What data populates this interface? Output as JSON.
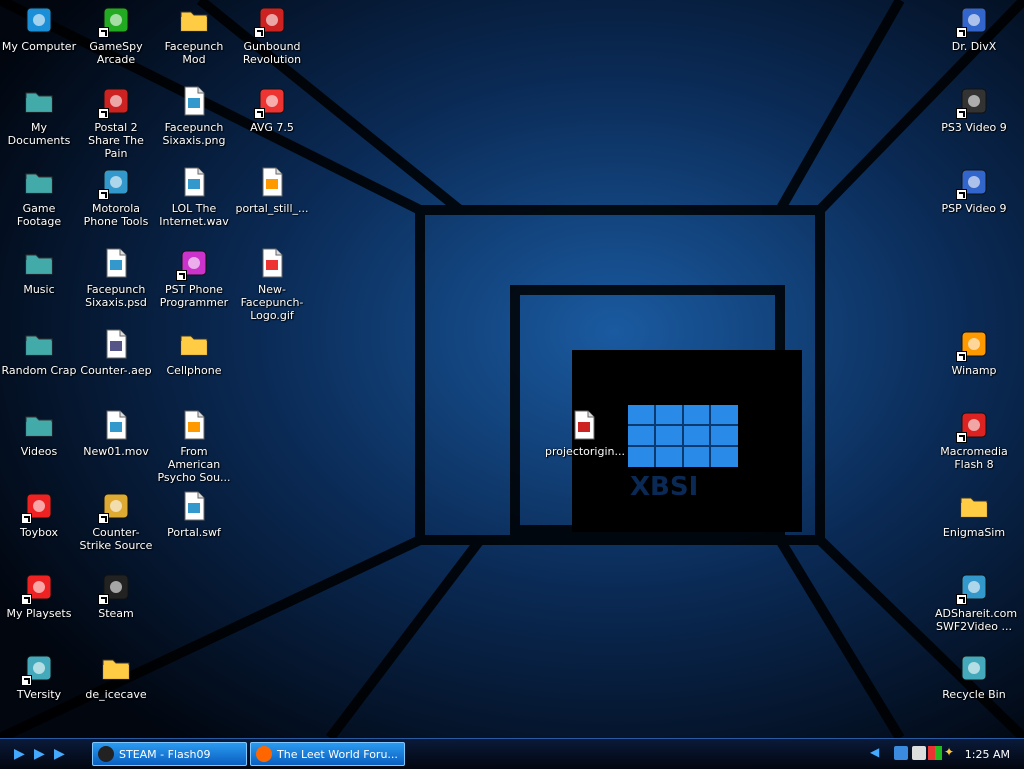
{
  "desktop": {
    "icons": [
      {
        "label": "My Computer",
        "icon": "my-computer-icon",
        "col": 0,
        "row": 0,
        "shortcut": false,
        "color": "#1a8fd8"
      },
      {
        "label": "My Documents",
        "icon": "folder-icon",
        "col": 0,
        "row": 1,
        "shortcut": false,
        "color": "#4aa"
      },
      {
        "label": "Game Footage",
        "icon": "folder-icon",
        "col": 0,
        "row": 2,
        "shortcut": false,
        "color": "#4aa"
      },
      {
        "label": "Music",
        "icon": "folder-icon",
        "col": 0,
        "row": 3,
        "shortcut": false,
        "color": "#4aa"
      },
      {
        "label": "Random Crap",
        "icon": "folder-icon",
        "col": 0,
        "row": 4,
        "shortcut": false,
        "color": "#4aa"
      },
      {
        "label": "Videos",
        "icon": "folder-icon",
        "col": 0,
        "row": 5,
        "shortcut": false,
        "color": "#4aa"
      },
      {
        "label": "Toybox",
        "icon": "toybox-icon",
        "col": 0,
        "row": 6,
        "shortcut": true,
        "color": "#e22"
      },
      {
        "label": "My Playsets",
        "icon": "playsets-icon",
        "col": 0,
        "row": 7,
        "shortcut": true,
        "color": "#e22"
      },
      {
        "label": "TVersity",
        "icon": "tversity-icon",
        "col": 0,
        "row": 8,
        "shortcut": true,
        "color": "#4ab"
      },
      {
        "label": "GameSpy Arcade",
        "icon": "gamespy-icon",
        "col": 1,
        "row": 0,
        "shortcut": true,
        "color": "#2a2"
      },
      {
        "label": "Postal 2 Share The Pain",
        "icon": "postal-icon",
        "col": 1,
        "row": 1,
        "shortcut": true,
        "color": "#c22"
      },
      {
        "label": "Motorola Phone Tools",
        "icon": "motorola-icon",
        "col": 1,
        "row": 2,
        "shortcut": true,
        "color": "#39c"
      },
      {
        "label": "Facepunch Sixaxis.psd",
        "icon": "psd-file-icon",
        "col": 1,
        "row": 3,
        "shortcut": false,
        "color": "#39c"
      },
      {
        "label": "Counter-.aep",
        "icon": "aep-file-icon",
        "col": 1,
        "row": 4,
        "shortcut": false,
        "color": "#558"
      },
      {
        "label": "New01.mov",
        "icon": "mov-file-icon",
        "col": 1,
        "row": 5,
        "shortcut": false,
        "color": "#39c"
      },
      {
        "label": "Counter-Strike Source",
        "icon": "counter-strike-icon",
        "col": 1,
        "row": 6,
        "shortcut": true,
        "color": "#da3"
      },
      {
        "label": "Steam",
        "icon": "steam-icon",
        "col": 1,
        "row": 7,
        "shortcut": true,
        "color": "#222"
      },
      {
        "label": "de_icecave",
        "icon": "folder-icon",
        "col": 1,
        "row": 8,
        "shortcut": false,
        "color": "#fc4"
      },
      {
        "label": "Facepunch Mod",
        "icon": "folder-icon",
        "col": 2,
        "row": 0,
        "shortcut": false,
        "color": "#fc4"
      },
      {
        "label": "Facepunch Sixaxis.png",
        "icon": "png-file-icon",
        "col": 2,
        "row": 1,
        "shortcut": false,
        "color": "#39c"
      },
      {
        "label": "LOL The Internet.wav",
        "icon": "wav-file-icon",
        "col": 2,
        "row": 2,
        "shortcut": false,
        "color": "#39c"
      },
      {
        "label": "PST Phone Programmer",
        "icon": "pst-icon",
        "col": 2,
        "row": 3,
        "shortcut": true,
        "color": "#c3c"
      },
      {
        "label": "Cellphone",
        "icon": "folder-icon",
        "col": 2,
        "row": 4,
        "shortcut": false,
        "color": "#fc4"
      },
      {
        "label": "From American Psycho Sou...",
        "icon": "vlc-file-icon",
        "col": 2,
        "row": 5,
        "shortcut": false,
        "color": "#f90"
      },
      {
        "label": "Portal.swf",
        "icon": "swf-file-icon",
        "col": 2,
        "row": 6,
        "shortcut": false,
        "color": "#39c"
      },
      {
        "label": "Gunbound Revolution",
        "icon": "gunbound-icon",
        "col": 3,
        "row": 0,
        "shortcut": true,
        "color": "#c22"
      },
      {
        "label": "AVG 7.5",
        "icon": "avg-icon",
        "col": 3,
        "row": 1,
        "shortcut": true,
        "color": "#e33"
      },
      {
        "label": "portal_still_...",
        "icon": "vlc-file-icon",
        "col": 3,
        "row": 2,
        "shortcut": false,
        "color": "#f90"
      },
      {
        "label": "New-Facepunch-Logo.gif",
        "icon": "gif-file-icon",
        "col": 3,
        "row": 3,
        "shortcut": false,
        "color": "#e33"
      },
      {
        "label": "Dr. DivX",
        "icon": "drdivx-icon",
        "col": "right",
        "row": 0,
        "shortcut": true,
        "color": "#36c"
      },
      {
        "label": "PS3 Video 9",
        "icon": "ps3-icon",
        "col": "right",
        "row": 1,
        "shortcut": true,
        "color": "#333"
      },
      {
        "label": "PSP Video 9",
        "icon": "psp-icon",
        "col": "right",
        "row": 2,
        "shortcut": true,
        "color": "#36c"
      },
      {
        "label": "Winamp",
        "icon": "winamp-icon",
        "col": "right",
        "row": 4,
        "shortcut": true,
        "color": "#f90"
      },
      {
        "label": "Macromedia Flash 8",
        "icon": "flash-icon",
        "col": "right",
        "row": 5,
        "shortcut": true,
        "color": "#d22"
      },
      {
        "label": "EnigmaSim",
        "icon": "folder-icon",
        "col": "right",
        "row": 6,
        "shortcut": false,
        "color": "#fc4"
      },
      {
        "label": "ADShareit.com SWF2Video ...",
        "icon": "swf2video-icon",
        "col": "right",
        "row": 7,
        "shortcut": true,
        "color": "#39c"
      },
      {
        "label": "Recycle Bin",
        "icon": "recycle-bin-icon",
        "col": "right",
        "row": 8,
        "shortcut": false,
        "color": "#4ab"
      },
      {
        "label": "projectorigin...",
        "icon": "projector-file-icon",
        "col": "center",
        "row": 5,
        "shortcut": false,
        "color": "#c22"
      }
    ]
  },
  "taskbar": {
    "quick_launch": [
      "quick-launch-1-icon",
      "quick-launch-2-icon",
      "quick-launch-3-icon"
    ],
    "tasks": [
      {
        "label": "STEAM - Flash09",
        "icon": "steam-icon"
      },
      {
        "label": "The Leet World Foru...",
        "icon": "firefox-icon"
      }
    ],
    "clock": "1:25 AM",
    "accent": "#2a9af0"
  }
}
